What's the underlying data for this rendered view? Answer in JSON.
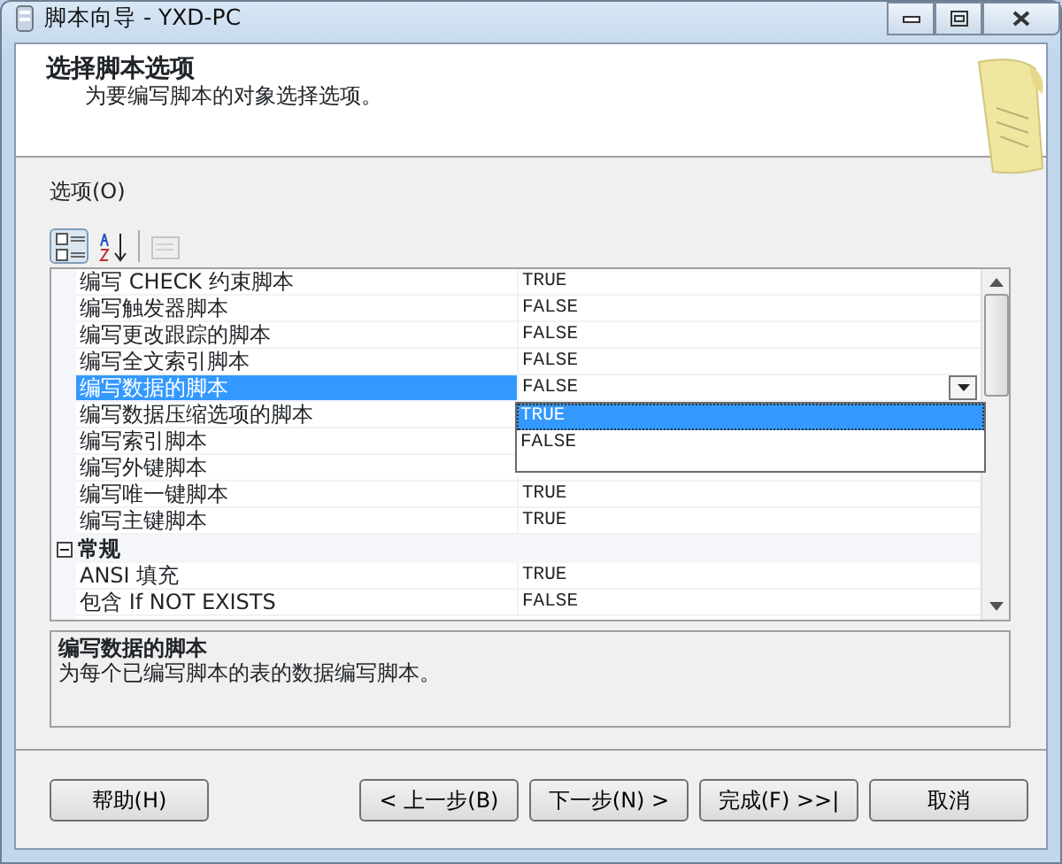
{
  "window": {
    "title": "脚本向导 - YXD-PC"
  },
  "header": {
    "title": "选择脚本选项",
    "subtitle": "为要编写脚本的对象选择选项。"
  },
  "options_label": "选项(O)",
  "toolbar": [
    {
      "kind": "categorized",
      "selected": true,
      "disabled": false
    },
    {
      "kind": "alphabetical",
      "selected": false,
      "disabled": false
    },
    {
      "kind": "pages",
      "selected": false,
      "disabled": true
    }
  ],
  "grid": {
    "rows": [
      {
        "kind": "property",
        "name": "编写 CHECK 约束脚本",
        "value": "TRUE",
        "selected": false
      },
      {
        "kind": "property",
        "name": "编写触发器脚本",
        "value": "FALSE",
        "selected": false
      },
      {
        "kind": "property",
        "name": "编写更改跟踪的脚本",
        "value": "FALSE",
        "selected": false
      },
      {
        "kind": "property",
        "name": "编写全文索引脚本",
        "value": "FALSE",
        "selected": false
      },
      {
        "kind": "property",
        "name": "编写数据的脚本",
        "value": "FALSE",
        "selected": true
      },
      {
        "kind": "property",
        "name": "编写数据压缩选项的脚本",
        "selected": false
      },
      {
        "kind": "property",
        "name": "编写索引脚本",
        "selected": false
      },
      {
        "kind": "property",
        "name": "编写外键脚本",
        "selected": false
      },
      {
        "kind": "property",
        "name": "编写唯一键脚本",
        "value": "TRUE",
        "selected": false
      },
      {
        "kind": "property",
        "name": "编写主键脚本",
        "value": "TRUE",
        "selected": false
      },
      {
        "kind": "category",
        "name": "常规",
        "expanded": true,
        "selected": false
      },
      {
        "kind": "property",
        "name": "ANSI 填充",
        "value": "TRUE",
        "selected": false
      },
      {
        "kind": "property",
        "name": "包含 If NOT EXISTS",
        "value": "FALSE",
        "selected": false
      }
    ],
    "dropdown": {
      "options": [
        {
          "label": "TRUE",
          "selected": true
        },
        {
          "label": "FALSE",
          "selected": false
        }
      ]
    }
  },
  "description": {
    "title": "编写数据的脚本",
    "text": "为每个已编写脚本的表的数据编写脚本。"
  },
  "buttons": [
    {
      "label": "帮助(H)",
      "kind": "left"
    },
    {
      "label": "< 上一步(B)",
      "kind": "right"
    },
    {
      "label": "下一步(N) >",
      "kind": "right"
    },
    {
      "label": "完成(F) >>|",
      "kind": "right"
    },
    {
      "label": "取消",
      "kind": "right"
    }
  ]
}
